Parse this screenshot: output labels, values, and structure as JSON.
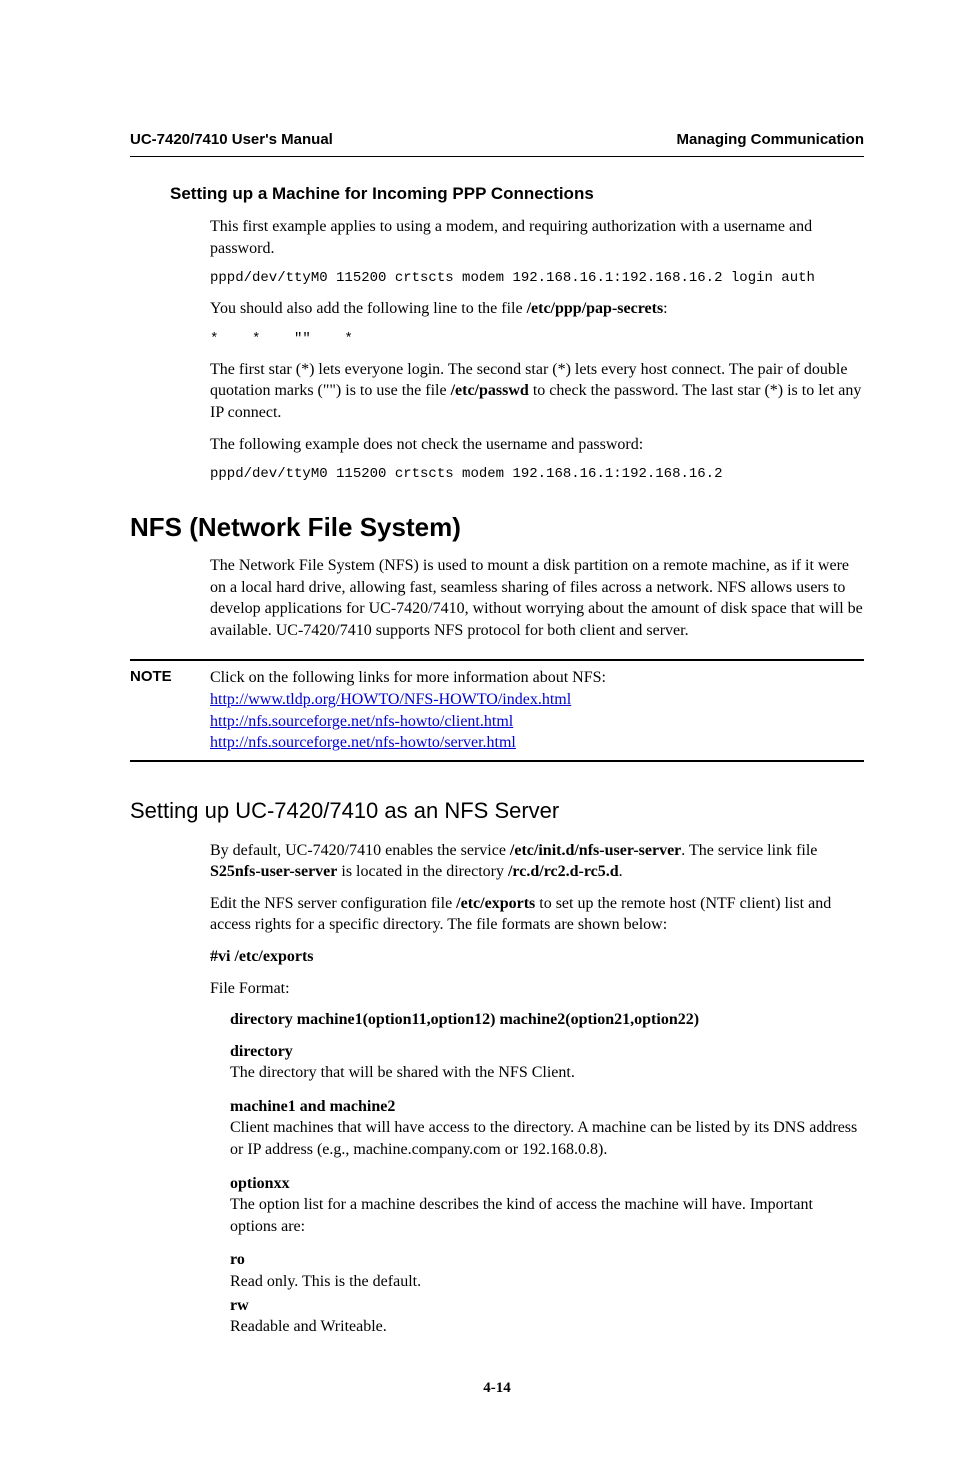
{
  "header": {
    "left": "UC-7420/7410 User's Manual",
    "right": "Managing Communication"
  },
  "sectionA": {
    "title": "Setting up a Machine for Incoming PPP Connections",
    "p1": "This first example applies to using a modem, and requiring authorization with a username and password.",
    "code1": "pppd/dev/ttyM0 115200 crtscts modem 192.168.16.1:192.168.16.2 login auth",
    "p2a": "You should also add the following line to the file ",
    "p2b": "/etc/ppp/pap-secrets",
    "p2c": ":",
    "code2": "*    *    \"\"    *",
    "p3a": "The first star (*) lets everyone login. The second star (*) lets every host connect. The pair of double quotation marks (\"\") is to use the file ",
    "p3b": "/etc/passwd",
    "p3c": " to check the password. The last star (*) is to let any IP connect.",
    "p4": "The following example does not check the username and password:",
    "code3": "pppd/dev/ttyM0 115200 crtscts modem 192.168.16.1:192.168.16.2"
  },
  "sectionB": {
    "title": "NFS (Network File System)",
    "p1": "The Network File System (NFS) is used to mount a disk partition on a remote machine, as if it were on a local hard drive, allowing fast, seamless sharing of files across a network. NFS allows users to develop applications for UC-7420/7410, without worrying about the amount of disk space that will be available. UC-7420/7410 supports NFS protocol for both client and server."
  },
  "note": {
    "label": "NOTE",
    "intro": "Click on the following links for more information about NFS:",
    "link1": "http://www.tldp.org/HOWTO/NFS-HOWTO/index.html",
    "link2": "http://nfs.sourceforge.net/nfs-howto/client.html",
    "link3": "http://nfs.sourceforge.net/nfs-howto/server.html"
  },
  "sectionC": {
    "title": "Setting up UC-7420/7410 as an NFS Server",
    "p1a": "By default, UC-7420/7410 enables the service ",
    "p1b": "/etc/init.d/nfs-user-server",
    "p1c": ". The service link file ",
    "p1d": "S25nfs-user-server",
    "p1e": " is located in the directory ",
    "p1f": "/rc.d/rc2.d-rc5.d",
    "p1g": ".",
    "p2a": "Edit the NFS server configuration file ",
    "p2b": "/etc/exports",
    "p2c": " to set up the remote host (NTF client) list and access rights for a specific directory. The file formats are shown below:",
    "p3": "#vi /etc/exports",
    "p4": "File Format:",
    "fmt": "directory machine1(option11,option12) machine2(option21,option22)",
    "d1t": "directory",
    "d1b": "The directory that will be shared with the NFS Client.",
    "d2t": "machine1 and machine2",
    "d2b": "Client machines that will have access to the directory. A machine can be listed by its DNS address or IP address (e.g., machine.company.com or 192.168.0.8).",
    "d3t": "optionxx",
    "d3b": "The option list for a machine describes the kind of access the machine will have. Important options are:",
    "d4t": "ro",
    "d4b": "Read only. This is the default.",
    "d5t": "rw",
    "d5b": "Readable and Writeable."
  },
  "footer": {
    "pagenum": "4-14"
  }
}
